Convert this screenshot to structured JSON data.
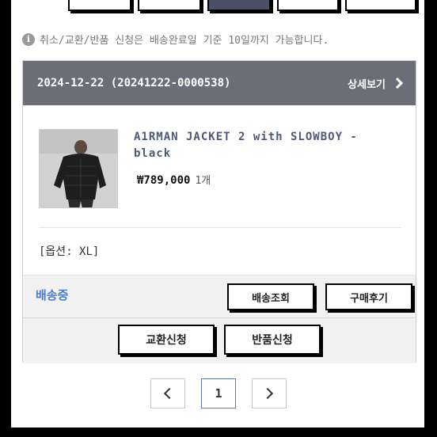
{
  "notice": {
    "icon": "info-icon",
    "text": "취소/교환/반품 신청은 배송완료일 기준 10일까지 가능합니다."
  },
  "order": {
    "header": "2024-12-22 (20241222-0000538)",
    "detail_label": "상세보기",
    "product": {
      "name": "A1RMAN JACKET 2 with SLOWBOY - black",
      "price": "₩789,000",
      "qty": "1개",
      "option": "[옵션: XL]"
    },
    "status": "배송중",
    "buttons": {
      "track": "배송조회",
      "review": "구매후기",
      "exchange": "교환신청",
      "return": "반품신청"
    }
  },
  "pagination": {
    "current": "1"
  },
  "colors": {
    "header_bg": "#6b6e78",
    "product_name": "#4b5a78",
    "status": "#4a7dc4",
    "active_tab": "#4a5166"
  }
}
